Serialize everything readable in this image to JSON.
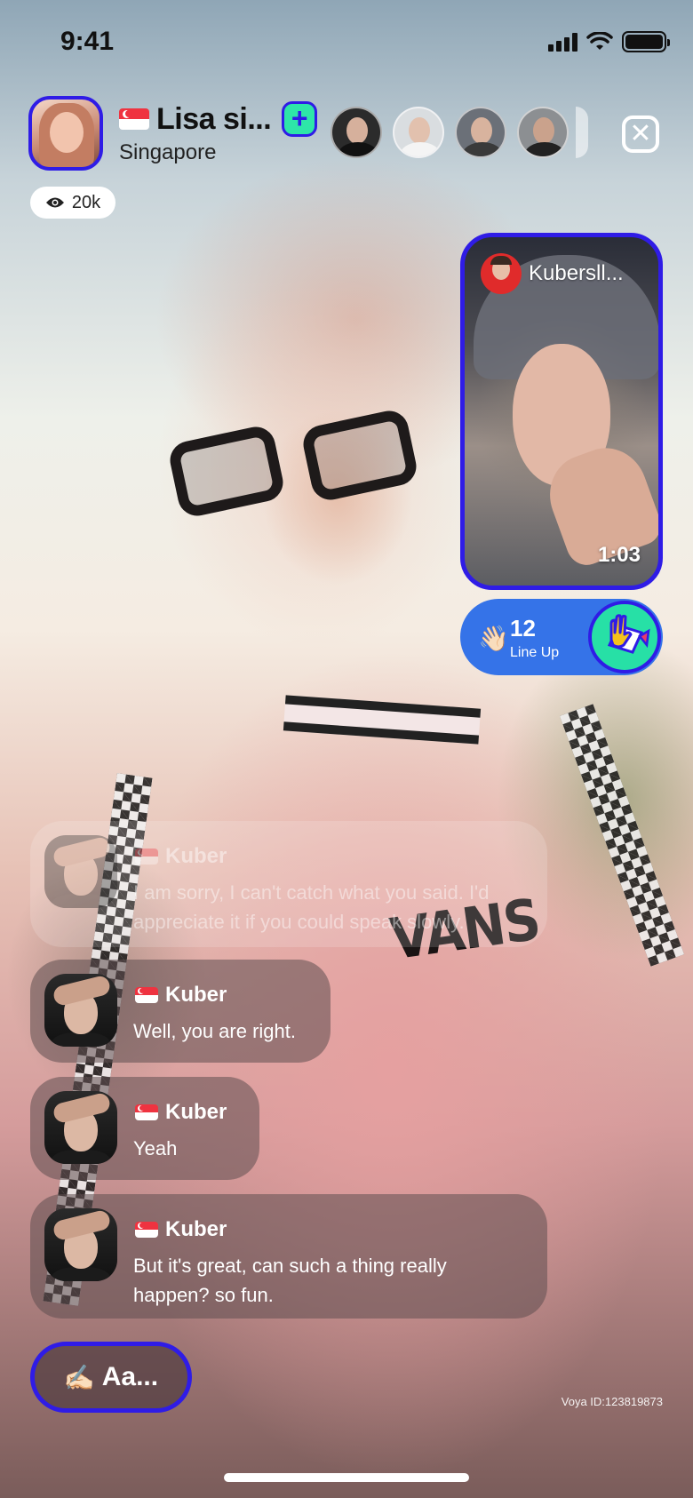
{
  "status_bar": {
    "time": "9:41"
  },
  "host": {
    "name": "Lisa si...",
    "location": "Singapore",
    "flag_icon": "singapore-flag-icon",
    "follow_icon": "+"
  },
  "viewers": {
    "count": "20k",
    "eye_icon": "eye-icon"
  },
  "close_icon": "✕",
  "guest": {
    "name": "Kubersll...",
    "timer": "1:03"
  },
  "lineup": {
    "icon": "👋🏻",
    "count": "12",
    "label": "Line Up"
  },
  "chat": [
    {
      "name": "Kuber",
      "text": "I am sorry, I can't catch what you said. I'd appreciate it if you could speak slowly."
    },
    {
      "name": "Kuber",
      "text": "Well, you are right."
    },
    {
      "name": "Kuber",
      "text": "Yeah"
    },
    {
      "name": "Kuber",
      "text": "But it's great, can such a thing really happen? so fun."
    }
  ],
  "compose": {
    "icon": "✍🏻",
    "label": "Aa..."
  },
  "user_id": "Voya ID:123819873",
  "colors": {
    "accent": "#2f1ce6",
    "mint": "#2ee6a8",
    "lineup_blue": "#3573e8"
  }
}
